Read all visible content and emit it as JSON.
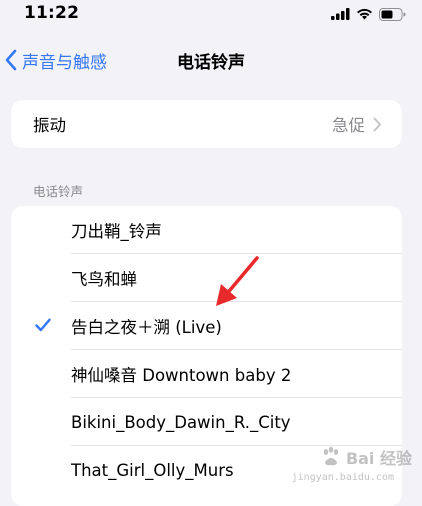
{
  "status_bar": {
    "time": "11:22",
    "icons": [
      "signal-icon",
      "wifi-icon",
      "battery-icon"
    ]
  },
  "nav": {
    "back_label": "声音与触感",
    "title": "电话铃声"
  },
  "vibration": {
    "label": "振动",
    "value": "急促"
  },
  "ringtones": {
    "section_header": "电话铃声",
    "items": [
      {
        "label": "刀出鞘_铃声",
        "selected": false
      },
      {
        "label": "飞鸟和蝉",
        "selected": false
      },
      {
        "label": "告白之夜＋溯 (Live)",
        "selected": true
      },
      {
        "label": "神仙嗓音 Downtown baby 2",
        "selected": false
      },
      {
        "label": "Bikini_Body_Dawin_R._City",
        "selected": false
      },
      {
        "label": "That_Girl_Olly_Murs",
        "selected": false
      }
    ]
  },
  "watermark": {
    "text": "Bai 经验",
    "sub": "jingyan.baidu.com"
  },
  "colors": {
    "accent": "#3478f6",
    "annotation": "#e8292b",
    "secondary_text": "#8a8a8e",
    "background": "#f2f2f7"
  }
}
